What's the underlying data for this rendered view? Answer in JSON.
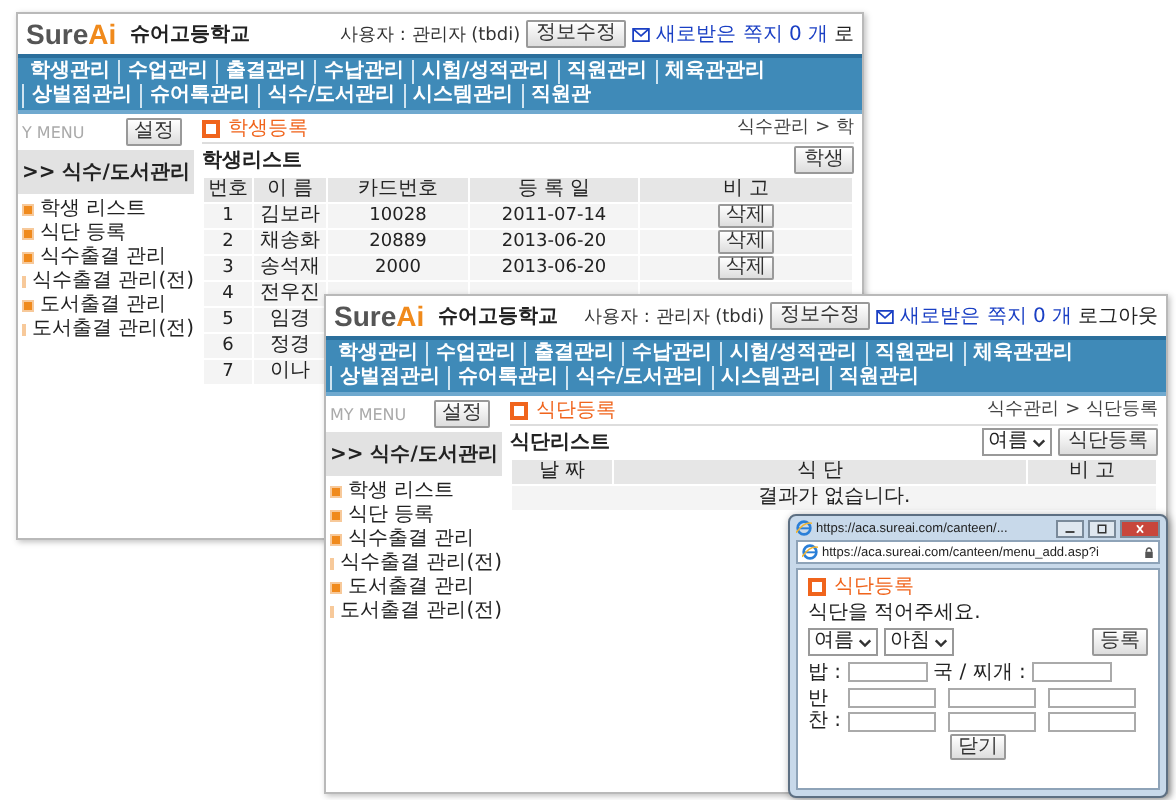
{
  "windows": [
    {
      "kind": "student_list",
      "logo": {
        "text": "Sure",
        "accent": "Ai"
      },
      "school": "슈어고등학교",
      "user": "사용자 : 관리자 (tbdi)",
      "edit_button": "정보수정",
      "messages": "새로받은 쪽지 0 개",
      "logout": "로",
      "nav": [
        "학생관리",
        "수업관리",
        "출결관리",
        "수납관리",
        "시험/성적관리",
        "직원관리",
        "체육관관리",
        "상벌점관리",
        "슈어톡관리",
        "식수/도서관리",
        "시스템관리",
        "직원관"
      ],
      "menu_field": {
        "placeholder": "Y MENU"
      },
      "settings_button": "설정",
      "sidebar_title": ">> 식수/도서관리",
      "sidebar_items": [
        "학생 리스트",
        "식단 등록",
        "식수출결 관리",
        "식수출결 관리(전)",
        "도서출결 관리",
        "도서출결 관리(전)"
      ],
      "page_title": "학생등록",
      "breadcrumb": "식수관리 > 학",
      "list_title": "학생리스트",
      "list_button": "학생",
      "table": {
        "columns": [
          "번호",
          "이 름",
          "카드번호",
          "등 록 일",
          "비 고"
        ],
        "rows": [
          {
            "cells": [
              "1",
              "김보라",
              "10028",
              "2011-07-14"
            ],
            "action": "삭제"
          },
          {
            "cells": [
              "2",
              "채송화",
              "20889",
              "2013-06-20"
            ],
            "action": "삭제"
          },
          {
            "cells": [
              "3",
              "송석재",
              "2000",
              "2013-06-20"
            ],
            "action": "삭제"
          },
          {
            "cells": [
              "4",
              "전우진"
            ]
          },
          {
            "cells": [
              "5",
              "임경"
            ]
          },
          {
            "cells": [
              "6",
              "정경"
            ]
          },
          {
            "cells": [
              "7",
              "이나"
            ]
          }
        ]
      }
    },
    {
      "kind": "meal_list",
      "logo": {
        "text": "Sure",
        "accent": "Ai"
      },
      "school": "슈어고등학교",
      "user": "사용자 : 관리자 (tbdi)",
      "edit_button": "정보수정",
      "messages": "새로받은 쪽지 0 개",
      "logout": "로그아웃",
      "nav": [
        "학생관리",
        "수업관리",
        "출결관리",
        "수납관리",
        "시험/성적관리",
        "직원관리",
        "체육관관리",
        "상벌점관리",
        "슈어톡관리",
        "식수/도서관리",
        "시스템관리",
        "직원관리"
      ],
      "menu_field": {
        "placeholder": "MY MENU"
      },
      "settings_button": "설정",
      "sidebar_title": ">> 식수/도서관리",
      "sidebar_items": [
        "학생 리스트",
        "식단 등록",
        "식수출결 관리",
        "식수출결 관리(전)",
        "도서출결 관리",
        "도서출결 관리(전)"
      ],
      "page_title": "식단등록",
      "breadcrumb": "식수관리 > 식단등록",
      "list_title": "식단리스트",
      "season_select": "여름",
      "list_button": "식단등록",
      "table": {
        "columns": [
          "날 짜",
          "식 단",
          "비 고"
        ],
        "empty_message": "결과가 없습니다."
      }
    }
  ],
  "popup": {
    "title": "https://aca.sureai.com/canteen/...",
    "address": "https://aca.sureai.com/canteen/menu_add.asp?i",
    "heading": "식단등록",
    "instruction": "식단을 적어주세요.",
    "selects": [
      "여름",
      "아침"
    ],
    "submit_button": "등록",
    "fields": [
      "밥 :",
      "국 / 찌개 :"
    ],
    "side_dish_label": "반찬 :",
    "close_button": "닫기"
  }
}
